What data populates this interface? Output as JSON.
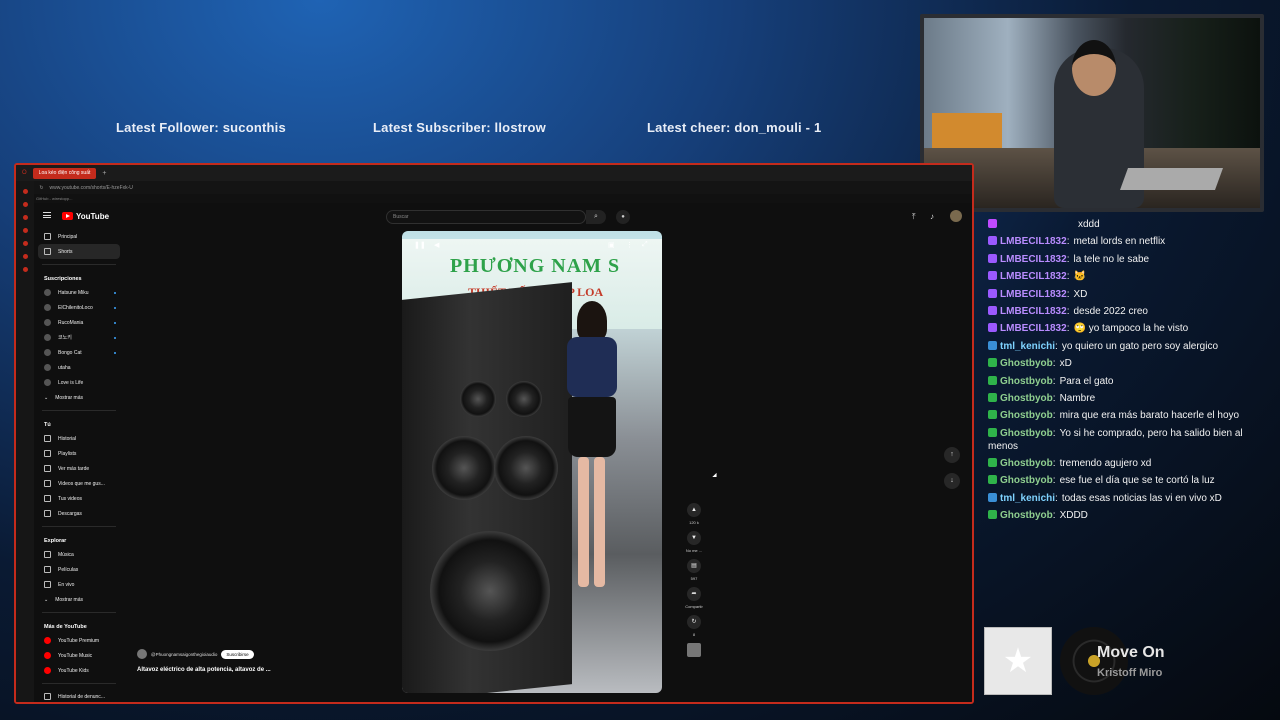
{
  "overlay": {
    "latest_follower": "Latest Follower: suconthis",
    "latest_subscriber": "Latest Subscriber: llostrow",
    "latest_cheer": "Latest cheer: don_mouli - 1"
  },
  "browser": {
    "tab_title": "Loa kéo điện công suất",
    "url": "www.youtube.com/shorts/E-hzeFxk-U",
    "bookmark": "GitHub - wirestopp..."
  },
  "youtube": {
    "logo": "YouTube",
    "search_placeholder": "Buscar",
    "sidebar": {
      "main": [
        "Principal",
        "Shorts"
      ],
      "subs_title": "Suscripciones",
      "subs": [
        "Hatsune Miku",
        "ElChilenitoLoco",
        "RucoMania",
        "코노키",
        "Bongo Cat",
        "utaha",
        "Love is Life"
      ],
      "subs_more": "Mostrar más",
      "you_title": "Tú",
      "you": [
        "Historial",
        "Playlists",
        "Ver más tarde",
        "Videos que me gus...",
        "Tus videos",
        "Descargas"
      ],
      "explore_title": "Explorar",
      "explore": [
        "Música",
        "Películas",
        "En vivo"
      ],
      "explore_more": "Mostrar más",
      "more_title": "Más de YouTube",
      "more": [
        "YouTube Premium",
        "YouTube Music",
        "YouTube Kids"
      ],
      "report": "Historial de denunc..."
    },
    "video": {
      "banner_line1": "PHƯƠNG NAM S",
      "banner_line2": "THIẾT KẾ ĐỘ RÁP LOA",
      "channel": "@Phuongnamsaigonthegioiaudio",
      "subscribe": "Suscribirse",
      "title": "Altavoz eléctrico de alta potencia, altavoz de ...",
      "likes": "120 k",
      "dislike": "No me ...",
      "comments": "597",
      "share": "Compartir",
      "remix": "8"
    }
  },
  "chat": [
    {
      "user": "",
      "text": "xddd",
      "color": "#c04aff",
      "badge": "#c04aff"
    },
    {
      "user": "LMBECIL1832",
      "text": "metal lords en netflix",
      "color": "#b98cff",
      "badge": "#9b59ff"
    },
    {
      "user": "LMBECIL1832",
      "text": "la tele no le sabe",
      "color": "#b98cff",
      "badge": "#9b59ff"
    },
    {
      "user": "LMBECIL1832",
      "text": "🐱",
      "color": "#b98cff",
      "badge": "#9b59ff"
    },
    {
      "user": "LMBECIL1832",
      "text": "XD",
      "color": "#b98cff",
      "badge": "#9b59ff"
    },
    {
      "user": "LMBECIL1832",
      "text": "desde 2022 creo",
      "color": "#b98cff",
      "badge": "#9b59ff"
    },
    {
      "user": "LMBECIL1832",
      "text": "🙄 yo tampoco la he visto",
      "color": "#b98cff",
      "badge": "#9b59ff"
    },
    {
      "user": "tml_kenichi",
      "text": "yo quiero un gato pero soy alergico",
      "color": "#7fd3ff",
      "badge": "#3a8fd6"
    },
    {
      "user": "Ghostbyob",
      "text": "xD",
      "color": "#8fcf8f",
      "badge": "#2fb34a"
    },
    {
      "user": "Ghostbyob",
      "text": "Para el gato",
      "color": "#8fcf8f",
      "badge": "#2fb34a"
    },
    {
      "user": "Ghostbyob",
      "text": "Nambre",
      "color": "#8fcf8f",
      "badge": "#2fb34a"
    },
    {
      "user": "Ghostbyob",
      "text": "mira que era más barato hacerle el hoyo",
      "color": "#8fcf8f",
      "badge": "#2fb34a"
    },
    {
      "user": "Ghostbyob",
      "text": "Yo si he comprado, pero ha salido bien al menos",
      "color": "#8fcf8f",
      "badge": "#2fb34a"
    },
    {
      "user": "Ghostbyob",
      "text": "tremendo agujero xd",
      "color": "#8fcf8f",
      "badge": "#2fb34a"
    },
    {
      "user": "Ghostbyob",
      "text": "ese fue el día que se te cortó la luz",
      "color": "#8fcf8f",
      "badge": "#2fb34a"
    },
    {
      "user": "tml_kenichi",
      "text": "todas esas noticias las vi en vivo xD",
      "color": "#7fd3ff",
      "badge": "#3a8fd6"
    },
    {
      "user": "Ghostbyob",
      "text": "XDDD",
      "color": "#8fcf8f",
      "badge": "#2fb34a"
    }
  ],
  "now_playing": {
    "track": "Move On",
    "artist": "Kristoff Miro"
  }
}
